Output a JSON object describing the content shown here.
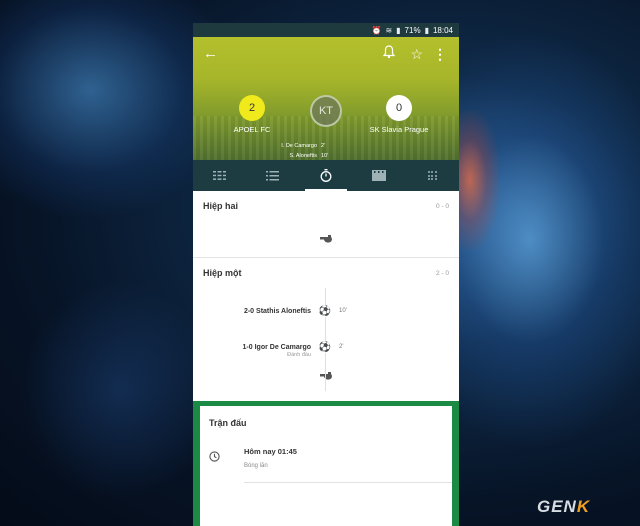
{
  "status_bar": {
    "battery": "71%",
    "time": "18:04"
  },
  "match": {
    "home_team": "APOEL FC",
    "home_score": "2",
    "away_team": "SK Slavia Prague",
    "away_score": "0",
    "status": "KT",
    "scorers": [
      {
        "name": "I. De Camargo",
        "minute": "2'"
      },
      {
        "name": "S. Aloneftis",
        "minute": "10'"
      }
    ]
  },
  "tabs": [
    {
      "icon": "lineup-icon"
    },
    {
      "icon": "list-icon"
    },
    {
      "icon": "stopwatch-icon",
      "active": true
    },
    {
      "icon": "video-icon"
    },
    {
      "icon": "pitch-icon"
    }
  ],
  "timeline": {
    "second_half": {
      "title": "Hiệp hai",
      "score": "0 - 0"
    },
    "first_half": {
      "title": "Hiệp một",
      "score": "2 - 0",
      "events": [
        {
          "score": "2-0",
          "player": "Stathis Aloneftis",
          "minute": "10'",
          "note": ""
        },
        {
          "score": "1-0",
          "player": "Igor De Camargo",
          "minute": "2'",
          "note": "Đánh đầu"
        }
      ]
    }
  },
  "match_card": {
    "title": "Trận đấu",
    "time": "Hôm nay 01:45",
    "sport": "Bóng lăn"
  },
  "watermark": {
    "prefix": "GEN",
    "suffix": "K"
  },
  "colors": {
    "hero": "#a6b52a",
    "tabs": "#1d3c41",
    "card_border": "#1a8a45",
    "home_crest": "#f0ea1c"
  }
}
